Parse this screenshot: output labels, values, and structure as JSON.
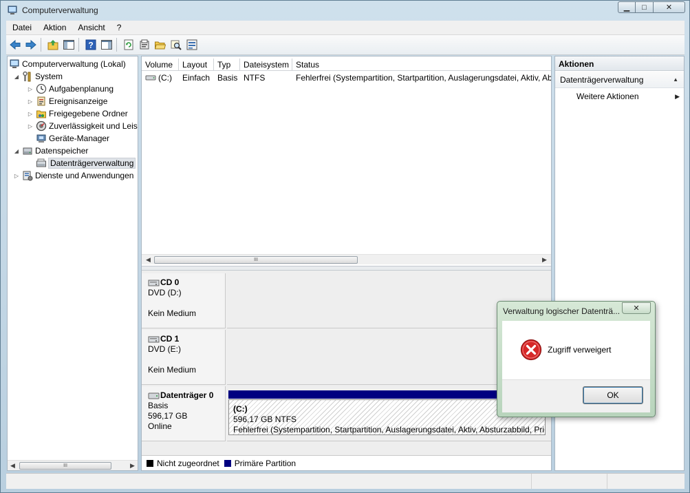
{
  "window": {
    "title": "Computerverwaltung",
    "caption": {
      "minimize": "▁",
      "maximize": "□",
      "close": "✕"
    }
  },
  "menu": [
    "Datei",
    "Aktion",
    "Ansicht",
    "?"
  ],
  "toolbar": {
    "icons": [
      "back-arrow-icon",
      "forward-arrow-icon",
      "up-folder-icon",
      "show-hide-console-tree-icon",
      "help-icon",
      "show-hide-action-pane-icon",
      "refresh-icon",
      "properties-icon",
      "open-folder-icon",
      "search-disk-icon",
      "settings-icon"
    ]
  },
  "tree": {
    "items": [
      {
        "label": "Computerverwaltung (Lokal)",
        "level": 0,
        "expander": "",
        "icon": "computer-management-icon"
      },
      {
        "label": "System",
        "level": 1,
        "expander": "◢",
        "icon": "system-tools-icon"
      },
      {
        "label": "Aufgabenplanung",
        "level": 2,
        "expander": "▷",
        "icon": "clock-icon"
      },
      {
        "label": "Ereignisanzeige",
        "level": 2,
        "expander": "▷",
        "icon": "event-viewer-icon"
      },
      {
        "label": "Freigegebene Ordner",
        "level": 2,
        "expander": "▷",
        "icon": "shared-folder-icon"
      },
      {
        "label": "Zuverlässigkeit und Leis",
        "level": 2,
        "expander": "▷",
        "icon": "performance-icon"
      },
      {
        "label": "Geräte-Manager",
        "level": 2,
        "expander": "",
        "icon": "device-manager-icon"
      },
      {
        "label": "Datenspeicher",
        "level": 1,
        "expander": "◢",
        "icon": "storage-icon"
      },
      {
        "label": "Datenträgerverwaltung",
        "level": 2,
        "expander": "",
        "icon": "disk-management-icon",
        "selected": true
      },
      {
        "label": "Dienste und Anwendungen",
        "level": 1,
        "expander": "▷",
        "icon": "services-icon"
      }
    ]
  },
  "volume_list": {
    "columns": [
      "Volume",
      "Layout",
      "Typ",
      "Dateisystem",
      "Status"
    ],
    "rows": [
      {
        "volume": "(C:)",
        "layout": "Einfach",
        "typ": "Basis",
        "dateisystem": "NTFS",
        "status": "Fehlerfrei (Systempartition, Startpartition, Auslagerungsdatei, Aktiv, Ab"
      }
    ]
  },
  "disks": [
    {
      "name": "CD 0",
      "line2": "DVD (D:)",
      "line3": "",
      "line4": "Kein Medium"
    },
    {
      "name": "CD 1",
      "line2": "DVD (E:)",
      "line3": "",
      "line4": "Kein Medium"
    },
    {
      "name": "Datenträger 0",
      "line2": "Basis",
      "line3": "596,17 GB",
      "line4": "Online",
      "partition": {
        "label": "(C:)",
        "size": "596,17 GB NTFS",
        "status": "Fehlerfrei (Systempartition, Startpartition, Auslagerungsdatei, Aktiv, Absturzabbild, Pri"
      }
    }
  ],
  "legend": [
    {
      "label": "Nicht zugeordnet",
      "color": "#000000"
    },
    {
      "label": "Primäre Partition",
      "color": "#000080"
    }
  ],
  "actions": {
    "header": "Aktionen",
    "section": "Datenträgerverwaltung",
    "item": "Weitere Aktionen"
  },
  "scroll": {
    "thumb_grip": "III"
  },
  "dialog": {
    "title": "Verwaltung logischer Datenträ...",
    "close": "✕",
    "message": "Zugriff verweigert",
    "ok_label": "OK"
  }
}
